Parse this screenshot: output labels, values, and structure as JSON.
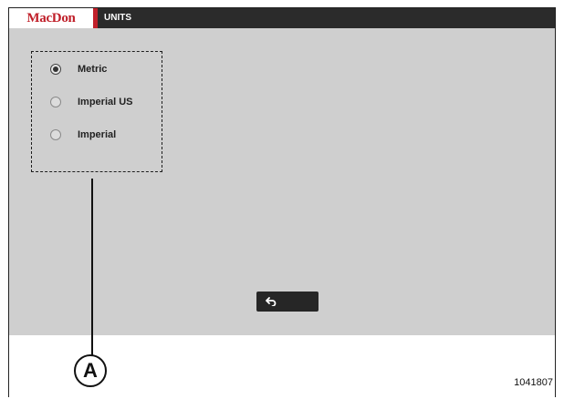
{
  "header": {
    "logo_text": "MacDon",
    "screen_title": "UNITS"
  },
  "units": {
    "options": [
      {
        "label": "Metric",
        "selected": true
      },
      {
        "label": "Imperial US",
        "selected": false
      },
      {
        "label": "Imperial",
        "selected": false
      }
    ]
  },
  "footer": {
    "back_icon": "back-arrow-icon"
  },
  "callout": {
    "label": "A"
  },
  "figure": {
    "number": "1041807"
  },
  "colors": {
    "brand_red": "#c0202a",
    "titlebar": "#2b2b2b",
    "screen_bg": "#cfcfcf"
  }
}
